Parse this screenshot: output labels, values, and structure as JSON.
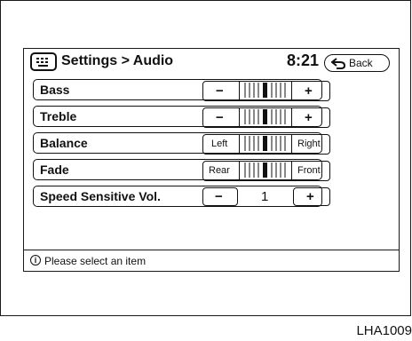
{
  "header": {
    "title": "Settings > Audio",
    "time": "8:21",
    "back_label": "Back"
  },
  "rows": [
    {
      "label": "Bass",
      "left": "−",
      "right": "+",
      "type": "slider"
    },
    {
      "label": "Treble",
      "left": "−",
      "right": "+",
      "type": "slider"
    },
    {
      "label": "Balance",
      "left": "Left",
      "right": "Right",
      "type": "slider"
    },
    {
      "label": "Fade",
      "left": "Rear",
      "right": "Front",
      "type": "slider"
    },
    {
      "label": "Speed Sensitive Vol.",
      "left": "−",
      "right": "+",
      "value": "1",
      "type": "stepper"
    }
  ],
  "status": {
    "message": "Please select an item",
    "icon": "info-icon"
  },
  "figure_code": "LHA1009"
}
